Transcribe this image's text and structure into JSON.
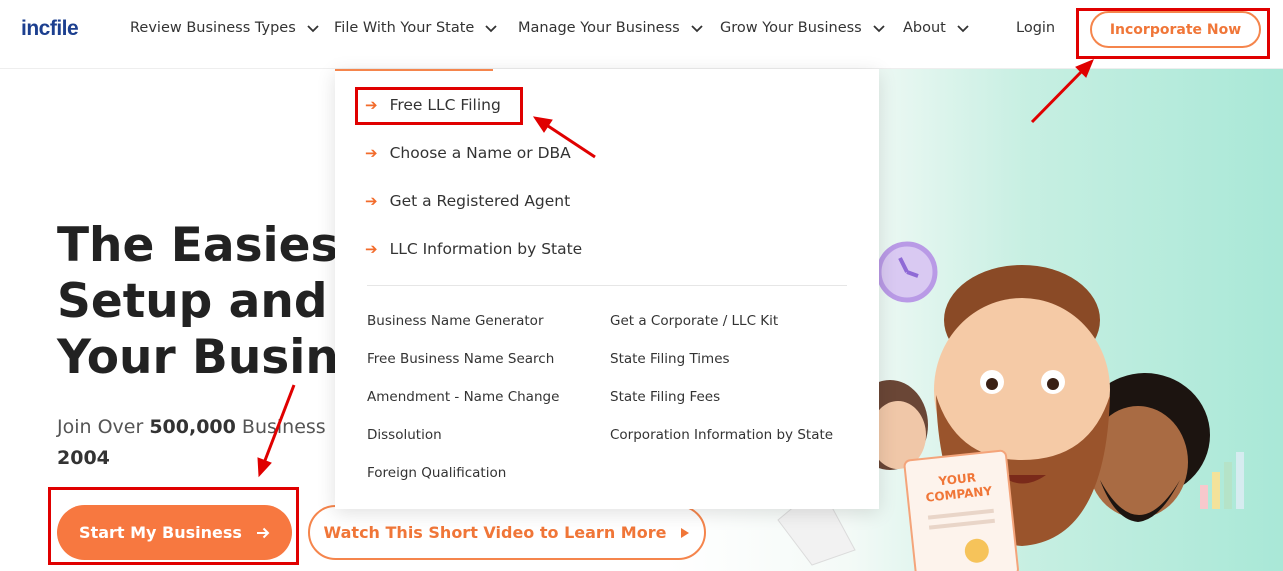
{
  "header": {
    "logo": "incfile",
    "nav": [
      {
        "label": "Review Business Types"
      },
      {
        "label": "File With Your State"
      },
      {
        "label": "Manage Your Business"
      },
      {
        "label": "Grow Your Business"
      },
      {
        "label": "About"
      }
    ],
    "login": "Login",
    "cta": "Incorporate Now"
  },
  "hero": {
    "title_line1": "The Easiest",
    "title_line2": "Setup and N",
    "title_line3": "Your Busine",
    "sub_prefix": "Join Over ",
    "sub_bold": "500,000",
    "sub_suffix": " Business",
    "sub_year": "2004",
    "start_button": "Start My Business",
    "video_button": "Watch This Short Video to Learn More"
  },
  "dropdown": {
    "main_items": [
      {
        "label": "Free LLC Filing"
      },
      {
        "label": "Choose a Name or DBA"
      },
      {
        "label": "Get a Registered Agent"
      },
      {
        "label": "LLC Information by State"
      }
    ],
    "left_links": [
      {
        "label": "Business Name Generator"
      },
      {
        "label": "Free Business Name Search"
      },
      {
        "label": "Amendment - Name Change"
      },
      {
        "label": "Dissolution"
      },
      {
        "label": "Foreign Qualification"
      }
    ],
    "right_links": [
      {
        "label": "Get a Corporate / LLC Kit"
      },
      {
        "label": "State Filing Times"
      },
      {
        "label": "State Filing Fees"
      },
      {
        "label": "Corporation Information by State"
      }
    ]
  },
  "illustration": {
    "card_line1": "YOUR",
    "card_line2": "COMPANY"
  },
  "colors": {
    "accent": "#f77840",
    "brand": "#1c3f8f",
    "annotation": "#e00000",
    "hero_mint": "#a9e8d7"
  },
  "icons": {
    "nav_chevron": "chevron-down-icon",
    "dropdown_arrow": "arrow-right-icon",
    "start_arrow": "arrow-right-icon",
    "video_play": "play-icon"
  }
}
